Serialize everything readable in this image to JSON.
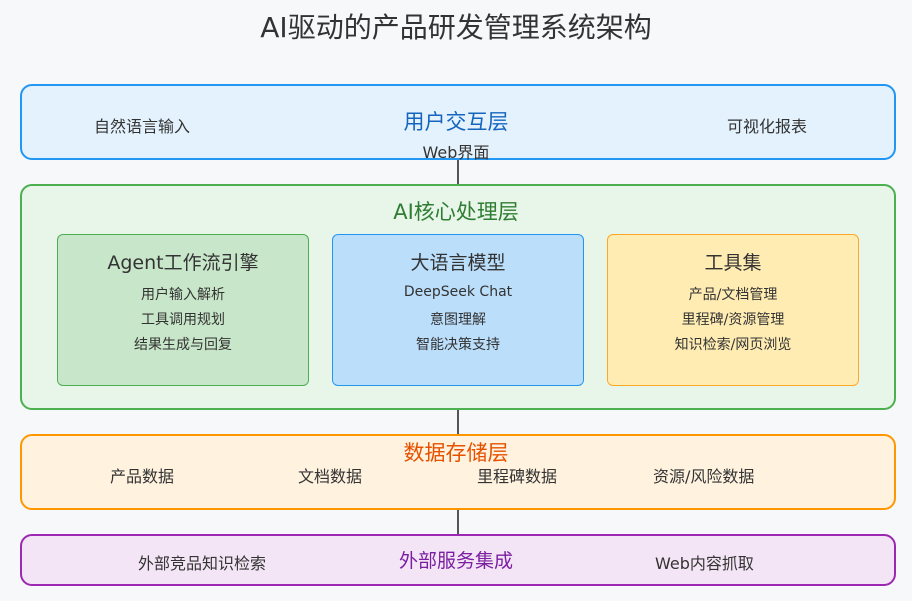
{
  "title": "AI驱动的产品研发管理系统架构",
  "layers": {
    "ui": {
      "title": "用户交互层",
      "left_label": "自然语言输入",
      "center_label": "Web界面",
      "right_label": "可视化报表"
    },
    "ai": {
      "title": "AI核心处理层",
      "boxes": [
        {
          "title": "Agent工作流引擎",
          "items": [
            "用户输入解析",
            "工具调用规划",
            "结果生成与回复"
          ]
        },
        {
          "title": "大语言模型",
          "items": [
            "DeepSeek Chat",
            "意图理解",
            "智能决策支持"
          ]
        },
        {
          "title": "工具集",
          "items": [
            "产品/文档管理",
            "里程碑/资源管理",
            "知识检索/网页浏览"
          ]
        }
      ]
    },
    "data": {
      "title": "数据存储层",
      "items": [
        "产品数据",
        "文档数据",
        "里程碑数据",
        "资源/风险数据"
      ]
    },
    "external": {
      "title": "外部服务集成",
      "left_label": "外部竞品知识检索",
      "right_label": "Web内容抓取"
    }
  },
  "colors": {
    "ui_border": "#2196f3",
    "ai_border": "#4caf50",
    "data_border": "#ff9800",
    "external_border": "#9c27b0"
  }
}
